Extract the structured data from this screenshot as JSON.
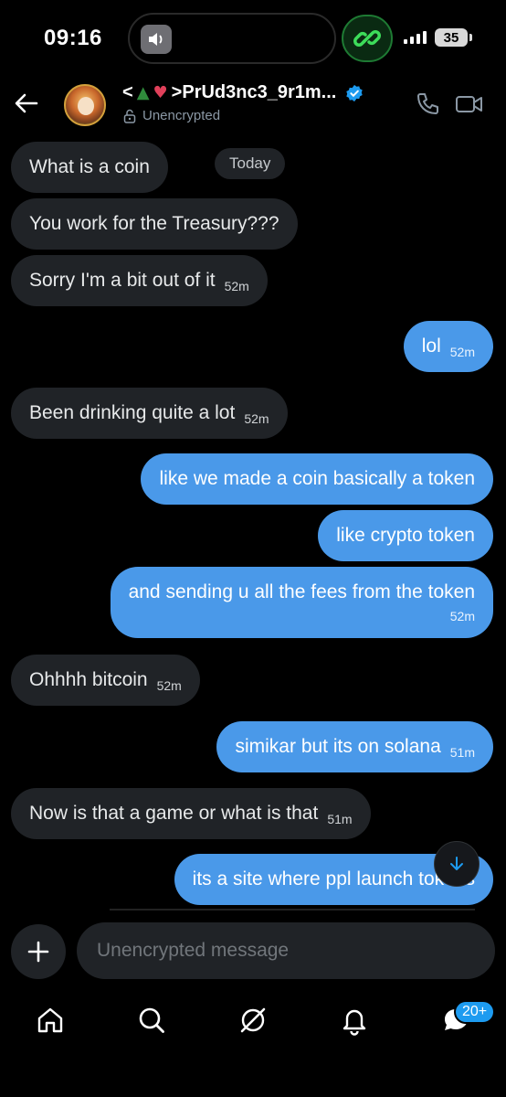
{
  "status_bar": {
    "time": "09:16",
    "battery": "35"
  },
  "header": {
    "title_prefix": "<",
    "title_name": ">PrUd3nc3_9r1m...",
    "subtitle": "Unencrypted"
  },
  "messages": [
    {
      "id": "m1",
      "dir": "in",
      "text": "What is a coin",
      "time": ""
    },
    {
      "id": "today",
      "text": "Today"
    },
    {
      "id": "m2",
      "dir": "in",
      "text": "You work for the Treasury???",
      "time": ""
    },
    {
      "id": "m3",
      "dir": "in",
      "text": "Sorry I'm a bit out of it",
      "time": "52m"
    },
    {
      "id": "m4",
      "dir": "out",
      "text": "lol",
      "time": "52m"
    },
    {
      "id": "m5",
      "dir": "in",
      "text": "Been drinking quite a lot",
      "time": "52m"
    },
    {
      "id": "m6",
      "dir": "out",
      "text": "like we made a coin basically a token",
      "time": ""
    },
    {
      "id": "m7",
      "dir": "out",
      "text": "like crypto token",
      "time": ""
    },
    {
      "id": "m8",
      "dir": "out",
      "text": "and sending u all the fees from the token",
      "time": "52m"
    },
    {
      "id": "m9",
      "dir": "in",
      "text": "Ohhhh bitcoin",
      "time": "52m"
    },
    {
      "id": "m10",
      "dir": "out",
      "text": "simikar but its on solana",
      "time": "51m"
    },
    {
      "id": "m11",
      "dir": "in",
      "text": "Now is that a game or what is that",
      "time": "51m"
    },
    {
      "id": "m12",
      "dir": "out",
      "text": "its a site where ppl launch tokens",
      "time": ""
    }
  ],
  "composer": {
    "placeholder": "Unencrypted message"
  },
  "nav": {
    "messages_badge": "20+"
  },
  "colors": {
    "outgoing_bubble": "#4a99e9",
    "incoming_bubble": "#202327",
    "background": "#000000",
    "accent": "#1d9bf0"
  },
  "icons": [
    "back-arrow-icon",
    "verified-badge-icon",
    "lock-open-icon",
    "phone-icon",
    "video-icon",
    "arrow-down-icon",
    "plus-icon",
    "home-icon",
    "search-icon",
    "grok-icon",
    "bell-icon",
    "messages-icon",
    "speaker-icon",
    "link-icon"
  ]
}
